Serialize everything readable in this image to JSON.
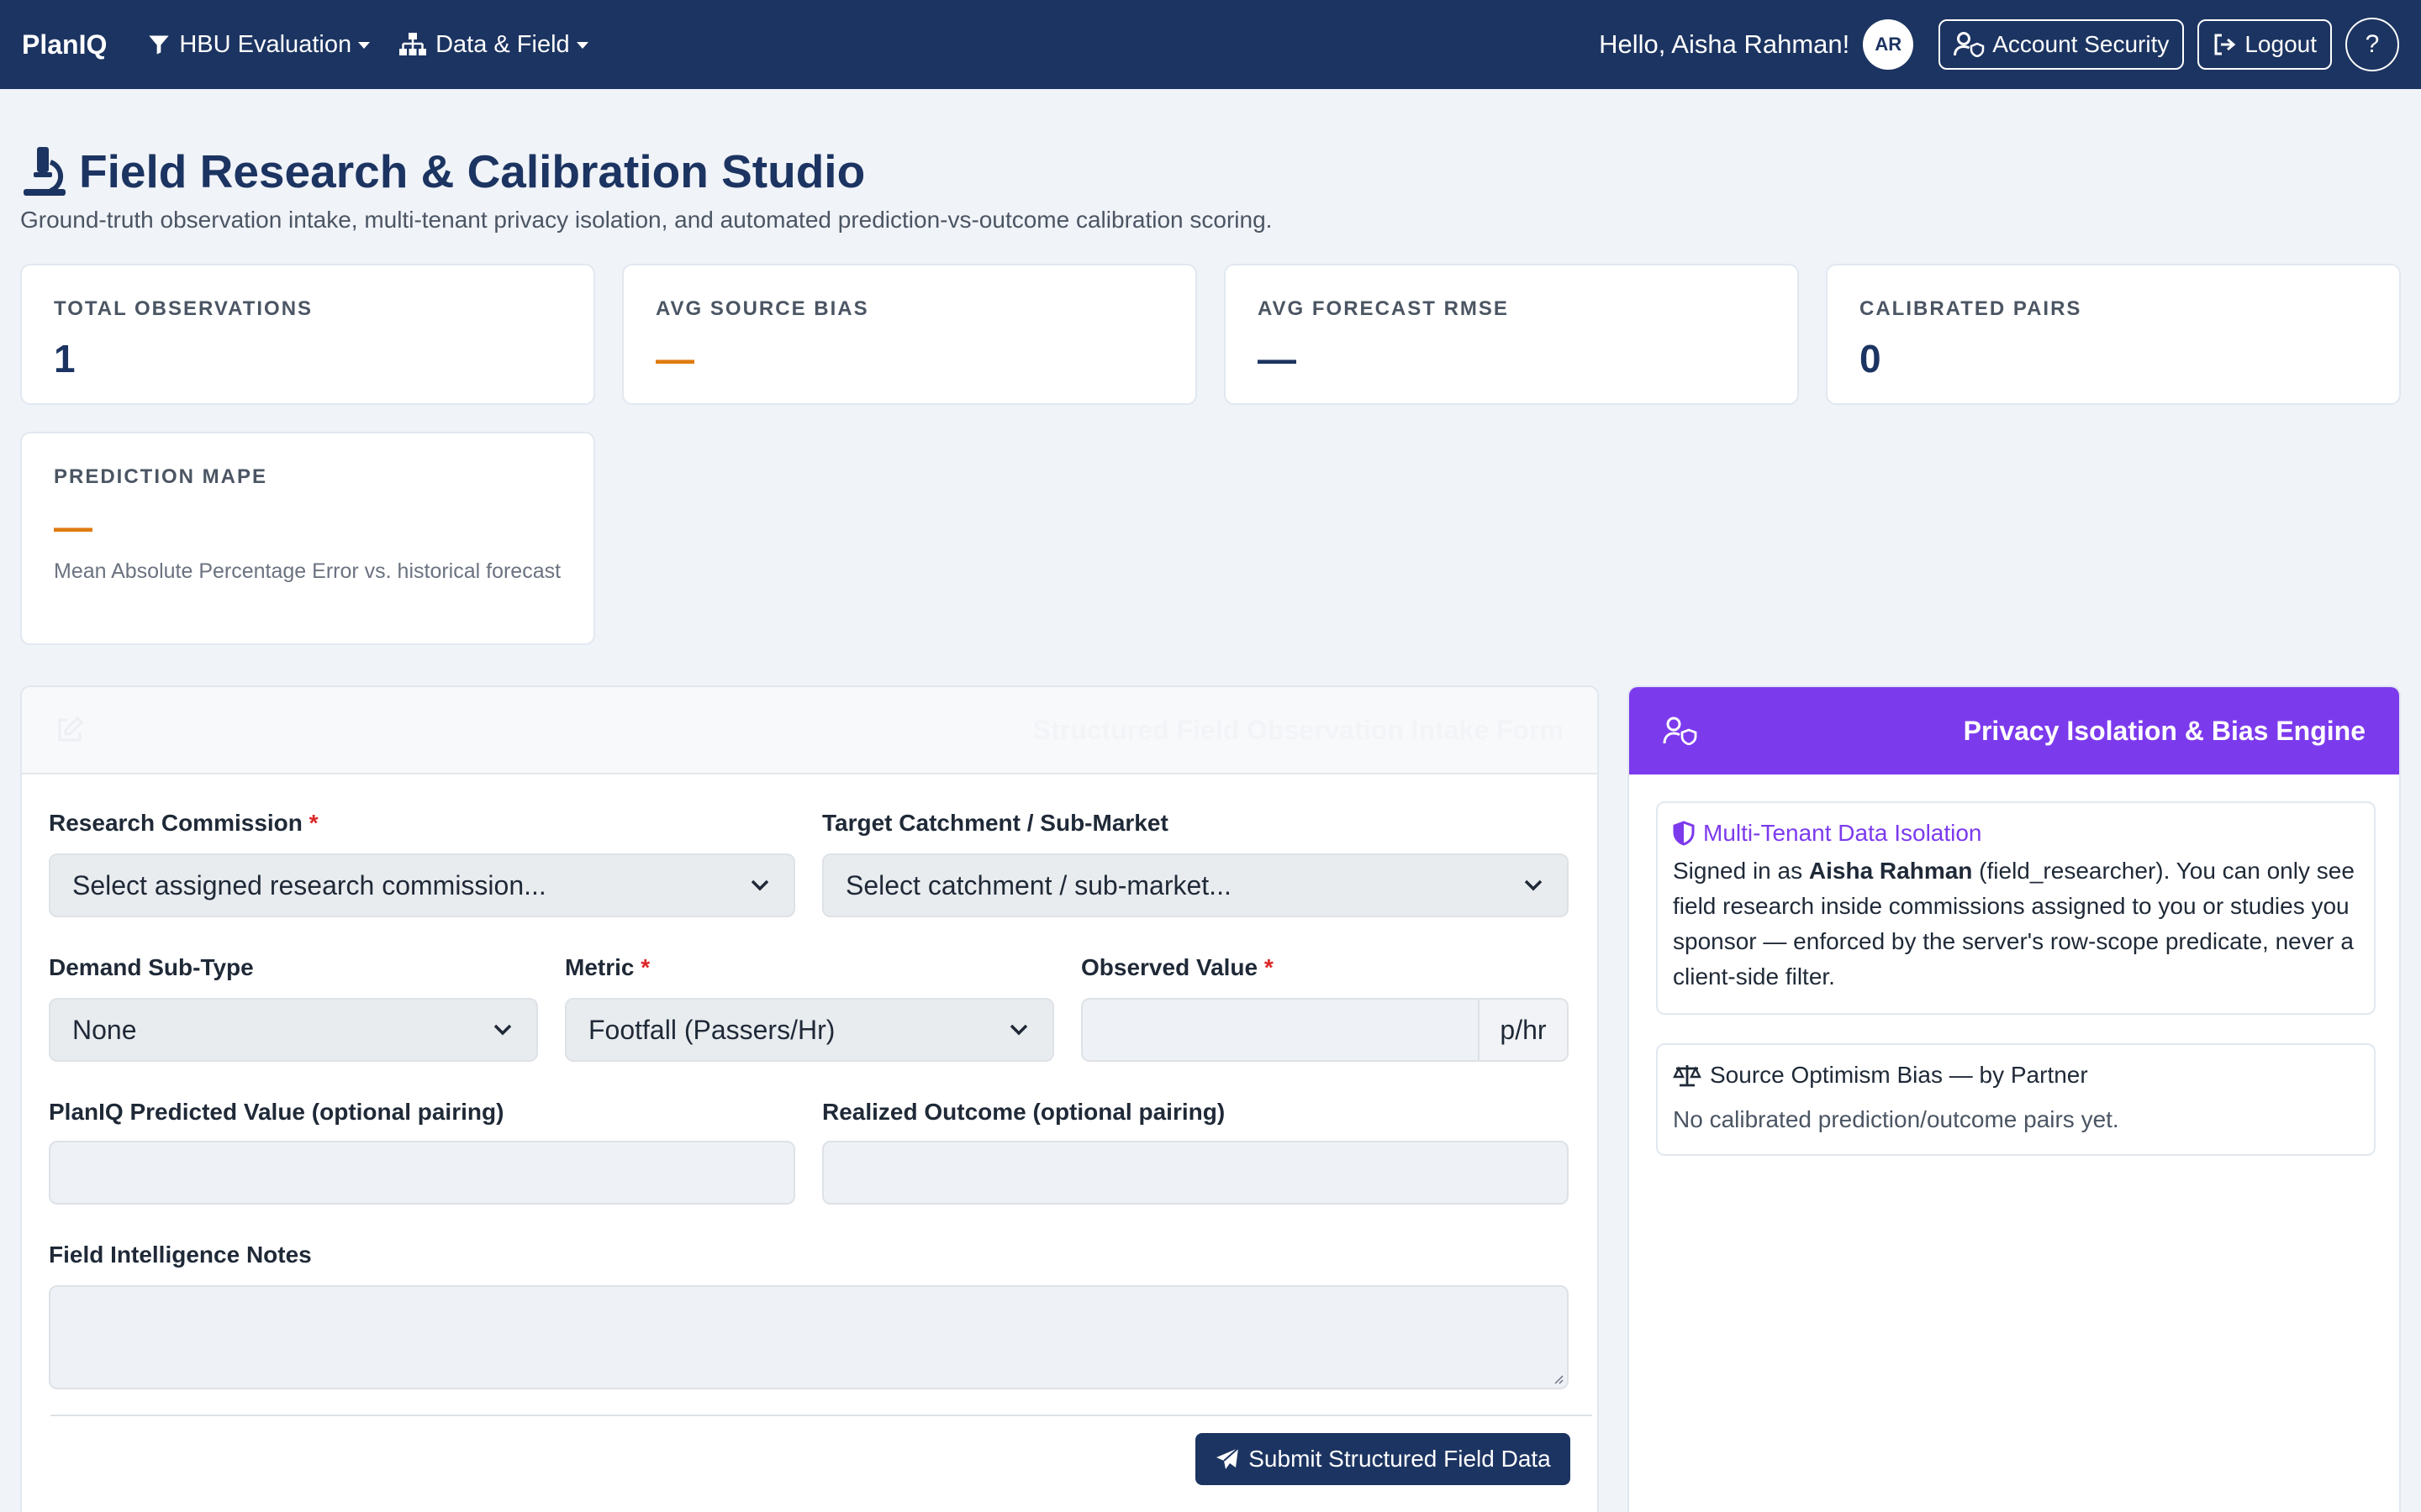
{
  "navbar": {
    "brand": "PlanIQ",
    "menu_hbu": "HBU Evaluation",
    "menu_data": "Data & Field",
    "greeting": "Hello, Aisha Rahman!",
    "avatar_initials": "AR",
    "account_security": "Account Security",
    "logout": "Logout",
    "help": "?"
  },
  "header": {
    "title": "Field Research & Calibration Studio",
    "subtitle": "Ground-truth observation intake, multi-tenant privacy isolation, and automated prediction-vs-outcome calibration scoring."
  },
  "stats": [
    {
      "label": "TOTAL OBSERVATIONS",
      "value": "1"
    },
    {
      "label": "AVG SOURCE BIAS",
      "value": "—"
    },
    {
      "label": "AVG FORECAST RMSE",
      "value": "—"
    },
    {
      "label": "CALIBRATED PAIRS",
      "value": "0"
    },
    {
      "label": "PREDICTION MAPE",
      "value": "—",
      "description": "Mean Absolute Percentage Error vs. historical forecast"
    }
  ],
  "form": {
    "title": "Structured Field Observation Intake Form",
    "commission_label": "Research Commission",
    "commission_value": "Select assigned research commission...",
    "catchment_label": "Target Catchment / Sub-Market",
    "catchment_value": "Select catchment / sub-market...",
    "demand_label": "Demand Sub-Type",
    "demand_value": "None",
    "metric_label": "Metric",
    "metric_value": "Footfall (Passers/Hr)",
    "observed_label": "Observed Value",
    "observed_unit": "p/hr",
    "predicted_label": "PlanIQ Predicted Value (optional pairing)",
    "realized_label": "Realized Outcome (optional pairing)",
    "notes_label": "Field Intelligence Notes",
    "required_mark": "*",
    "submit": "Submit Structured Field Data"
  },
  "privacy": {
    "title": "Privacy Isolation & Bias Engine",
    "isolation_title": "Multi-Tenant Data Isolation",
    "isolation_prefix": "Signed in as ",
    "isolation_name": "Aisha Rahman",
    "isolation_body": " (field_researcher). You can only see field research inside commissions assigned to you or studies you sponsor — enforced by the server's row-scope predicate, never a client-side filter.",
    "bias_title": "Source Optimism Bias — by Partner",
    "bias_empty": "No calibrated prediction/outcome pairs yet."
  },
  "colors": {
    "navbar": "#1c3461",
    "accent_purple": "#7c3aed",
    "accent_orange": "#e07b12",
    "required_red": "#dc2626"
  }
}
